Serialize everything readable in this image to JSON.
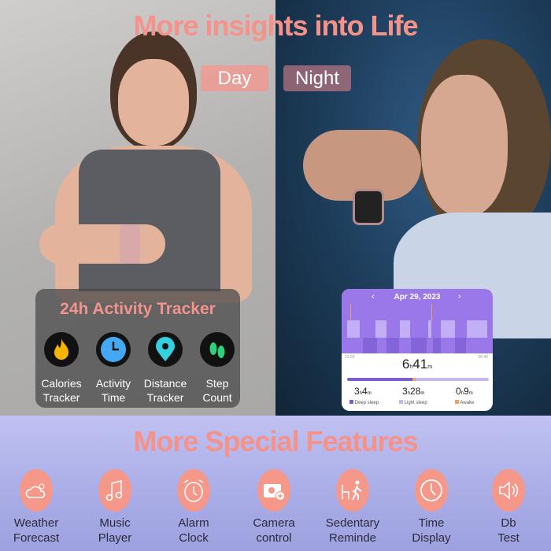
{
  "header": {
    "title": "More insights into Life",
    "day_label": "Day",
    "night_label": "Night"
  },
  "activity": {
    "title": "24h Activity Tracker",
    "items": [
      {
        "icon": "flame-icon",
        "line1": "Calories",
        "line2": "Tracker"
      },
      {
        "icon": "clock-icon",
        "line1": "Activity",
        "line2": "Time"
      },
      {
        "icon": "location-pin-icon",
        "line1": "Distance",
        "line2": "Tracker"
      },
      {
        "icon": "footprints-icon",
        "line1": "Step",
        "line2": "Count"
      }
    ]
  },
  "sleep": {
    "date": "Apr 29, 2023",
    "start": "23:59",
    "end": "06:40",
    "total": {
      "h": "6",
      "m": "41"
    },
    "deep": {
      "h": "3",
      "m": "4"
    },
    "light": {
      "h": "3",
      "m": "28"
    },
    "awake": {
      "h": "0",
      "m": "9"
    },
    "legend": [
      "Deep sleep",
      "Light sleep",
      "Awake"
    ],
    "colors": {
      "deep": "#7b5fd0",
      "light": "#c6b6f3",
      "awake": "#f0a060"
    }
  },
  "features": {
    "title": "More Special Features",
    "items": [
      {
        "icon": "weather-icon",
        "line1": "Weather",
        "line2": "Forecast"
      },
      {
        "icon": "music-icon",
        "line1": "Music",
        "line2": "Player"
      },
      {
        "icon": "alarm-clock-icon",
        "line1": "Alarm",
        "line2": "Clock"
      },
      {
        "icon": "camera-icon",
        "line1": "Camera",
        "line2": "control"
      },
      {
        "icon": "sedentary-icon",
        "line1": "Sedentary",
        "line2": "Reminde"
      },
      {
        "icon": "clock-icon",
        "line1": "Time",
        "line2": "Display"
      },
      {
        "icon": "speaker-icon",
        "line1": "Db",
        "line2": "Test"
      }
    ]
  },
  "colors": {
    "accent": "#f5928a",
    "feature_bg": "#b4b7ea"
  }
}
